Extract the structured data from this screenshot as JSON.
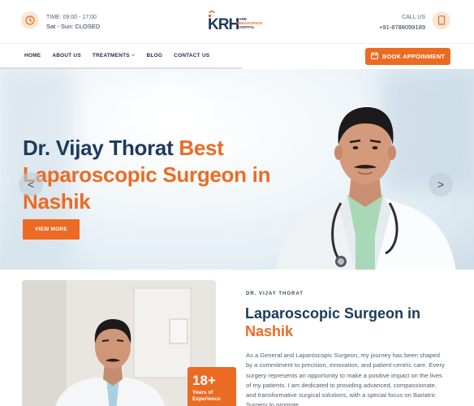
{
  "topbar": {
    "time_line": "TIME: 09:00 - 17:00",
    "days_line": "Sat - Sun: CLOSED",
    "logo_letters": "KRH",
    "logo_name_line1": "KARE",
    "logo_name_line2": "RENASCENCE",
    "logo_name_line3": "HOSPITAL",
    "call_label": "CALL US",
    "phone": "+91-8788099189"
  },
  "nav": {
    "items": [
      "HOME",
      "ABOUT US",
      "TREATMENTS",
      "BLOG",
      "CONTACT US"
    ],
    "book_label": "BOOK APPOINMENT"
  },
  "hero": {
    "name": "Dr. Vijay Thorat",
    "title_rest": " Best Laparoscopic Surgeon in Nashik",
    "cta": "VIEW MORE",
    "prev_arrow": "<",
    "next_arrow": ">"
  },
  "about": {
    "badge_number": "18+",
    "badge_text": "Years of Experience",
    "eyebrow": "DR. VIJAY THORAT",
    "title_dark": "Laparoscopic Surgeon in",
    "title_orange": "Nashik",
    "paragraph": "As a General and Laparoscopic Surgeon, my journey has been shaped by a commitment to precision, innovation, and patient-centric care. Every surgery represents an opportunity to make a positive impact on the lives of my patients. I am dedicated to providing advanced, compassionate, and transformative surgical solutions, with a special focus on Bariatric Surgery to promote"
  },
  "colors": {
    "accent": "#ec6b23",
    "navy": "#1d3a5c",
    "icon_bg": "#fbe6d4"
  },
  "icons": [
    "clock-icon",
    "phone-icon",
    "calendar-icon",
    "chevron-down-icon"
  ]
}
